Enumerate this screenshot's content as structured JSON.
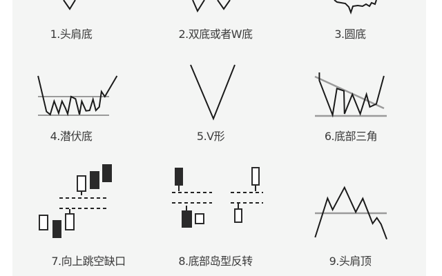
{
  "patterns": [
    {
      "label": "1.头肩底"
    },
    {
      "label": "2.双底或者W底"
    },
    {
      "label": "3.圆底"
    },
    {
      "label": "4.潜伏底"
    },
    {
      "label": "5.V形"
    },
    {
      "label": "6.底部三角"
    },
    {
      "label": "7.向上跳空缺口"
    },
    {
      "label": "8.底部岛型反转"
    },
    {
      "label": "9.头肩顶"
    }
  ],
  "colors": {
    "line": "#1a1a1a",
    "support_line": "#9a9a9a",
    "background": "#f4f5f4"
  }
}
